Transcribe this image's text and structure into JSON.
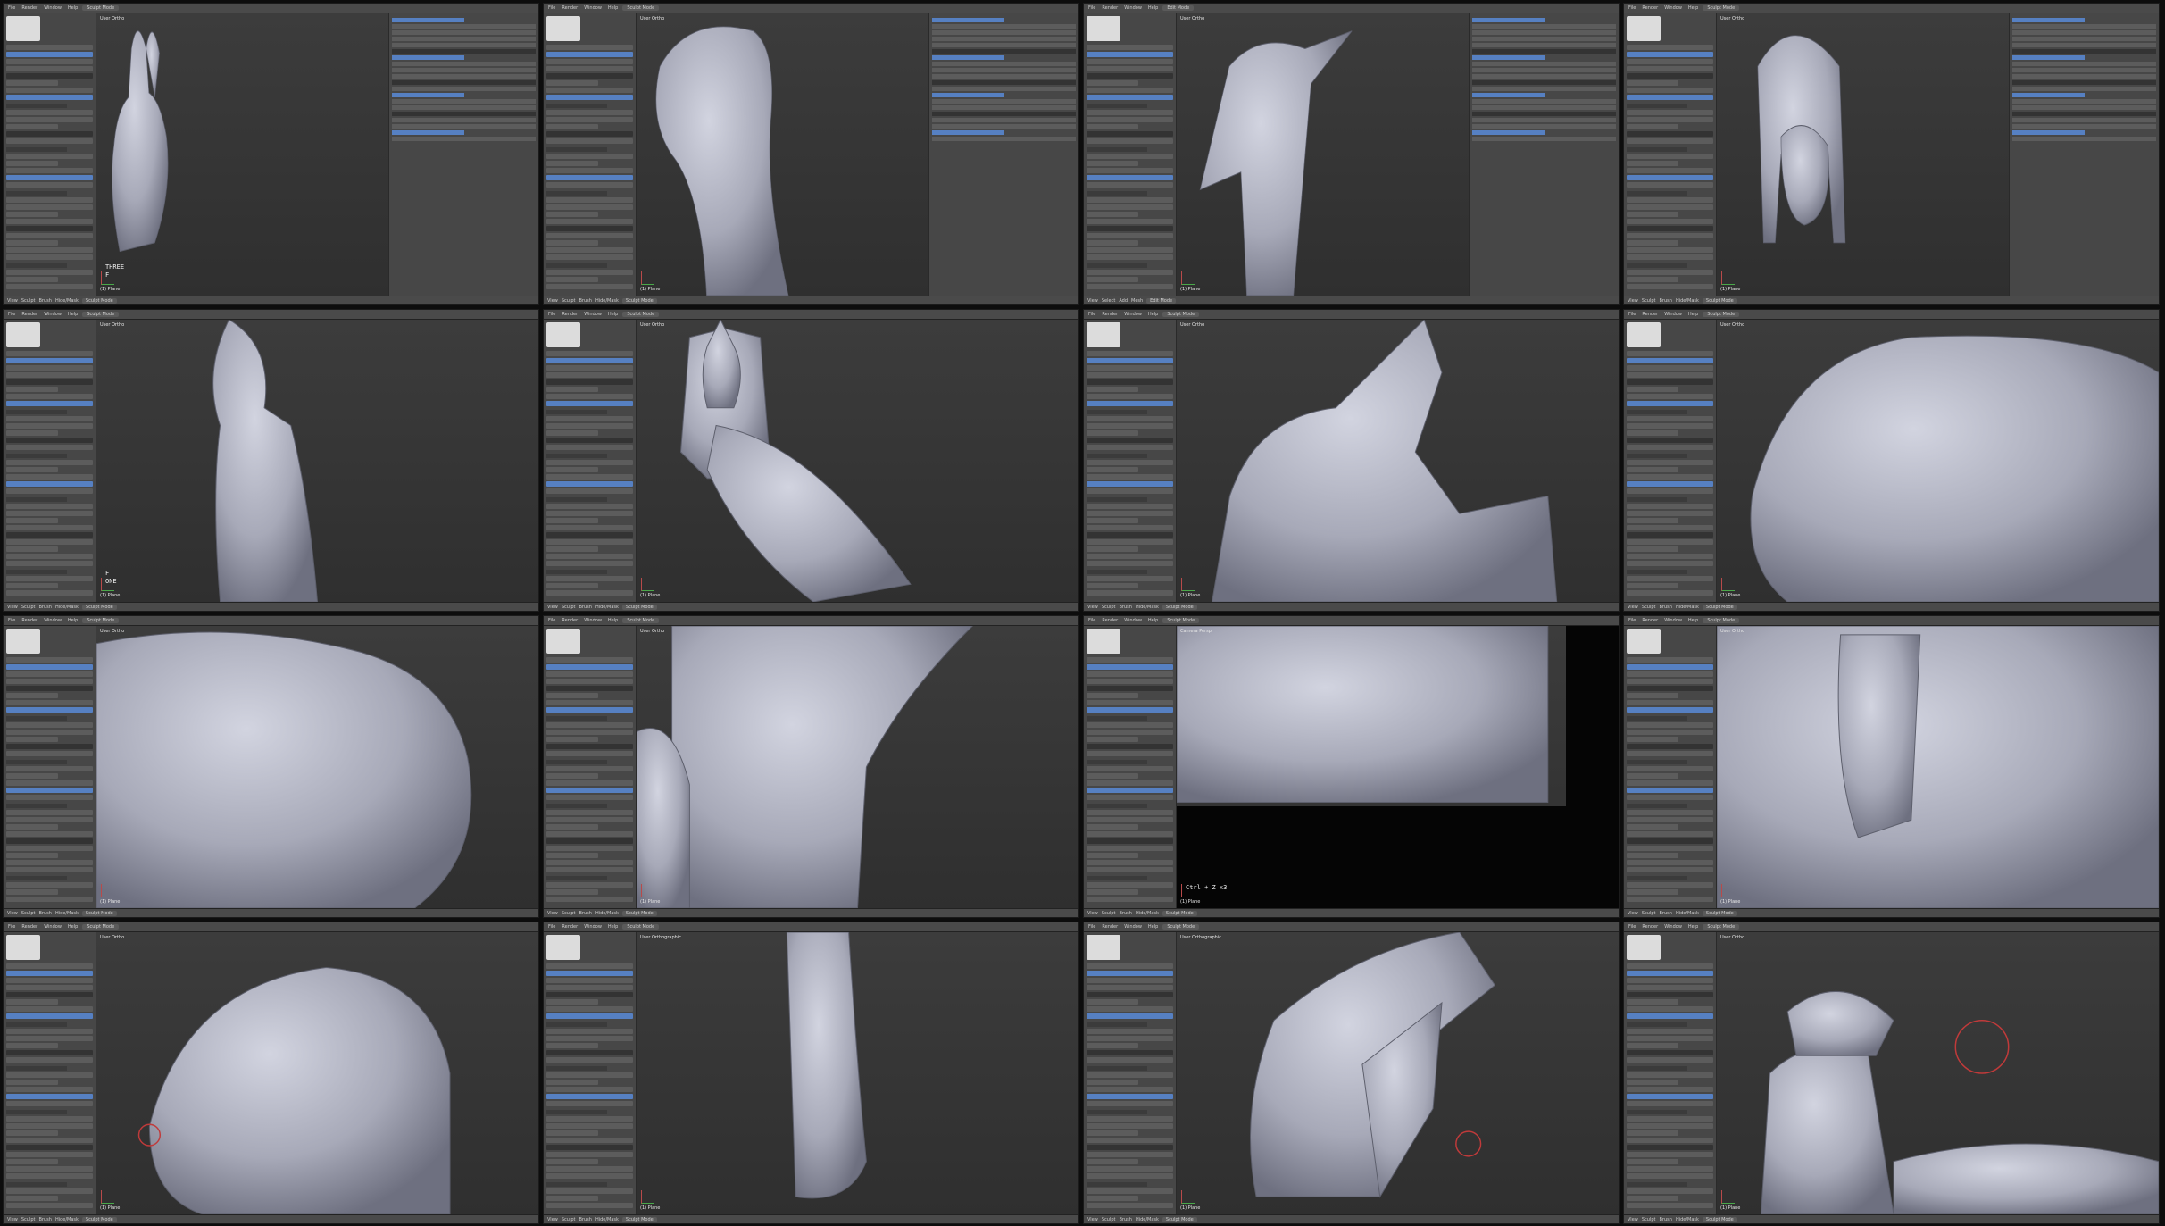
{
  "colors": {
    "background": "#0d0d0d",
    "panel": "#474747",
    "header": "#4a4a4a",
    "viewport": "#353535",
    "model": "#a7a9b8",
    "accent": "#5680c2",
    "brush_circle": "#c03a3a"
  },
  "frames": [
    {
      "view_label": "User Ortho",
      "object_label": "(1) Plane",
      "key_hint": "THREE\nF",
      "menus": [
        "File",
        "Render",
        "Window",
        "Help"
      ],
      "mode": "Sculpt Mode",
      "bottom_menus": [
        "View",
        "Sculpt",
        "Brush",
        "Hide/Mask"
      ],
      "side_panels": "left+right",
      "subject": "bust"
    },
    {
      "view_label": "User Ortho",
      "object_label": "(1) Plane",
      "key_hint": "",
      "menus": [
        "File",
        "Render",
        "Window",
        "Help"
      ],
      "mode": "Sculpt Mode",
      "bottom_menus": [
        "View",
        "Sculpt",
        "Brush",
        "Hide/Mask"
      ],
      "side_panels": "left+right",
      "subject": "neck"
    },
    {
      "view_label": "User Ortho",
      "object_label": "(1) Plane",
      "key_hint": "",
      "menus": [
        "File",
        "Render",
        "Window",
        "Help"
      ],
      "mode": "Edit Mode",
      "bottom_menus": [
        "View",
        "Select",
        "Add",
        "Mesh"
      ],
      "side_panels": "left-menu+right",
      "subject": "lowpoly"
    },
    {
      "view_label": "User Ortho",
      "object_label": "(1) Plane",
      "key_hint": "",
      "menus": [
        "File",
        "Render",
        "Window",
        "Help"
      ],
      "mode": "Sculpt Mode",
      "bottom_menus": [
        "View",
        "Sculpt",
        "Brush",
        "Hide/Mask"
      ],
      "side_panels": "left+right",
      "subject": "headdress"
    },
    {
      "view_label": "User Ortho",
      "object_label": "(1) Plane",
      "key_hint": "F\nONE",
      "menus": [
        "File",
        "Render",
        "Window",
        "Help"
      ],
      "mode": "Sculpt Mode",
      "bottom_menus": [
        "View",
        "Sculpt",
        "Brush",
        "Hide/Mask"
      ],
      "side_panels": "left",
      "subject": "profile"
    },
    {
      "view_label": "User Ortho",
      "object_label": "(1) Plane",
      "key_hint": "",
      "menus": [
        "File",
        "Render",
        "Window",
        "Help"
      ],
      "mode": "Sculpt Mode",
      "bottom_menus": [
        "View",
        "Sculpt",
        "Brush",
        "Hide/Mask"
      ],
      "side_panels": "left",
      "subject": "cat-front"
    },
    {
      "view_label": "User Ortho",
      "object_label": "(1) Plane",
      "key_hint": "",
      "menus": [
        "File",
        "Render",
        "Window",
        "Help"
      ],
      "mode": "Sculpt Mode",
      "bottom_menus": [
        "View",
        "Sculpt",
        "Brush",
        "Hide/Mask"
      ],
      "side_panels": "left",
      "subject": "ear-side"
    },
    {
      "view_label": "User Ortho",
      "object_label": "(1) Plane",
      "key_hint": "",
      "menus": [
        "File",
        "Render",
        "Window",
        "Help"
      ],
      "mode": "Sculpt Mode",
      "bottom_menus": [
        "View",
        "Sculpt",
        "Brush",
        "Hide/Mask"
      ],
      "side_panels": "left",
      "subject": "closeup-nose"
    },
    {
      "view_label": "User Ortho",
      "object_label": "(1) Plane",
      "key_hint": "",
      "menus": [
        "File",
        "Render",
        "Window",
        "Help"
      ],
      "mode": "Sculpt Mode",
      "bottom_menus": [
        "View",
        "Sculpt",
        "Brush",
        "Hide/Mask"
      ],
      "side_panels": "left",
      "subject": "face-eye"
    },
    {
      "view_label": "User Ortho",
      "object_label": "(1) Plane",
      "key_hint": "",
      "menus": [
        "File",
        "Render",
        "Window",
        "Help"
      ],
      "mode": "Sculpt Mode",
      "bottom_menus": [
        "View",
        "Sculpt",
        "Brush",
        "Hide/Mask"
      ],
      "side_panels": "left",
      "subject": "neck-detail"
    },
    {
      "view_label": "Camera Persp",
      "object_label": "(1) Plane",
      "key_hint": "Ctrl + Z x3",
      "menus": [
        "File",
        "Render",
        "Window",
        "Help"
      ],
      "mode": "Sculpt Mode",
      "bottom_menus": [
        "View",
        "Sculpt",
        "Brush",
        "Hide/Mask"
      ],
      "side_panels": "left",
      "subject": "render-crop"
    },
    {
      "view_label": "User Ortho",
      "object_label": "(1) Plane",
      "key_hint": "",
      "menus": [
        "File",
        "Render",
        "Window",
        "Help"
      ],
      "mode": "Sculpt Mode",
      "bottom_menus": [
        "View",
        "Sculpt",
        "Brush",
        "Hide/Mask"
      ],
      "side_panels": "left",
      "subject": "lappet-closeup"
    },
    {
      "view_label": "User Ortho",
      "object_label": "(1) Plane",
      "key_hint": "",
      "menus": [
        "File",
        "Render",
        "Window",
        "Help"
      ],
      "mode": "Sculpt Mode",
      "bottom_menus": [
        "View",
        "Sculpt",
        "Brush",
        "Hide/Mask"
      ],
      "side_panels": "left",
      "subject": "cat-side-hood"
    },
    {
      "view_label": "User Orthographic",
      "object_label": "(1) Plane",
      "key_hint": "",
      "menus": [
        "File",
        "Render",
        "Window",
        "Help"
      ],
      "mode": "Sculpt Mode",
      "bottom_menus": [
        "View",
        "Sculpt",
        "Brush",
        "Hide/Mask"
      ],
      "side_panels": "left",
      "subject": "single-lappet"
    },
    {
      "view_label": "User Orthographic",
      "object_label": "(1) Plane",
      "key_hint": "",
      "menus": [
        "File",
        "Render",
        "Window",
        "Help"
      ],
      "mode": "Sculpt Mode",
      "bottom_menus": [
        "View",
        "Sculpt",
        "Brush",
        "Hide/Mask"
      ],
      "side_panels": "left",
      "subject": "two-lappets"
    },
    {
      "view_label": "User Ortho",
      "object_label": "(1) Plane",
      "key_hint": "",
      "menus": [
        "File",
        "Render",
        "Window",
        "Help"
      ],
      "mode": "Sculpt Mode",
      "bottom_menus": [
        "View",
        "Sculpt",
        "Brush",
        "Hide/Mask"
      ],
      "side_panels": "left",
      "subject": "top-knot"
    }
  ]
}
